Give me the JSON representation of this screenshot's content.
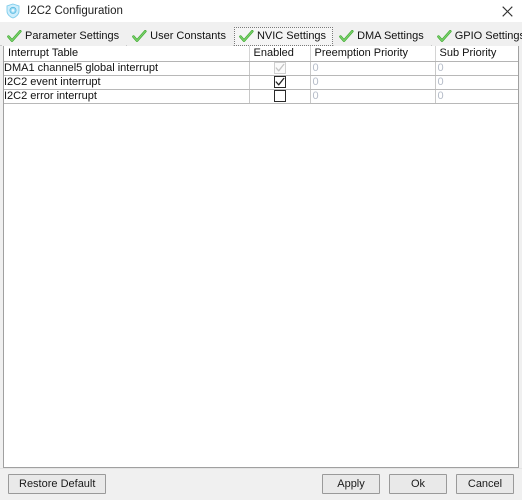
{
  "window": {
    "title": "I2C2 Configuration",
    "icon": "shield-config-icon",
    "close_label": "✕"
  },
  "tabs": [
    {
      "label": "Parameter Settings",
      "selected": false,
      "icon": "green-check-icon"
    },
    {
      "label": "User Constants",
      "selected": false,
      "icon": "green-check-icon"
    },
    {
      "label": "NVIC Settings",
      "selected": true,
      "icon": "green-check-icon"
    },
    {
      "label": "DMA Settings",
      "selected": false,
      "icon": "green-check-icon"
    },
    {
      "label": "GPIO Settings",
      "selected": false,
      "icon": "green-check-icon"
    }
  ],
  "table": {
    "columns": [
      "Interrupt Table",
      "Enabled",
      "Preemption Priority",
      "Sub Priority"
    ],
    "rows": [
      {
        "name": "DMA1 channel5 global interrupt",
        "enabled": true,
        "enabled_state": "checked-disabled",
        "preemption_priority": "0",
        "sub_priority": "0"
      },
      {
        "name": "I2C2 event interrupt",
        "enabled": true,
        "enabled_state": "checked",
        "preemption_priority": "0",
        "sub_priority": "0"
      },
      {
        "name": "I2C2 error interrupt",
        "enabled": false,
        "enabled_state": "unchecked",
        "preemption_priority": "0",
        "sub_priority": "0"
      }
    ]
  },
  "footer": {
    "restore_default": "Restore Default",
    "apply": "Apply",
    "ok": "Ok",
    "cancel": "Cancel"
  },
  "colors": {
    "accent_green": "#4caf3f",
    "icon_blue": "#49b6e8",
    "placeholder": "#b5bcc8",
    "window_bg": "#f0f0f0"
  }
}
